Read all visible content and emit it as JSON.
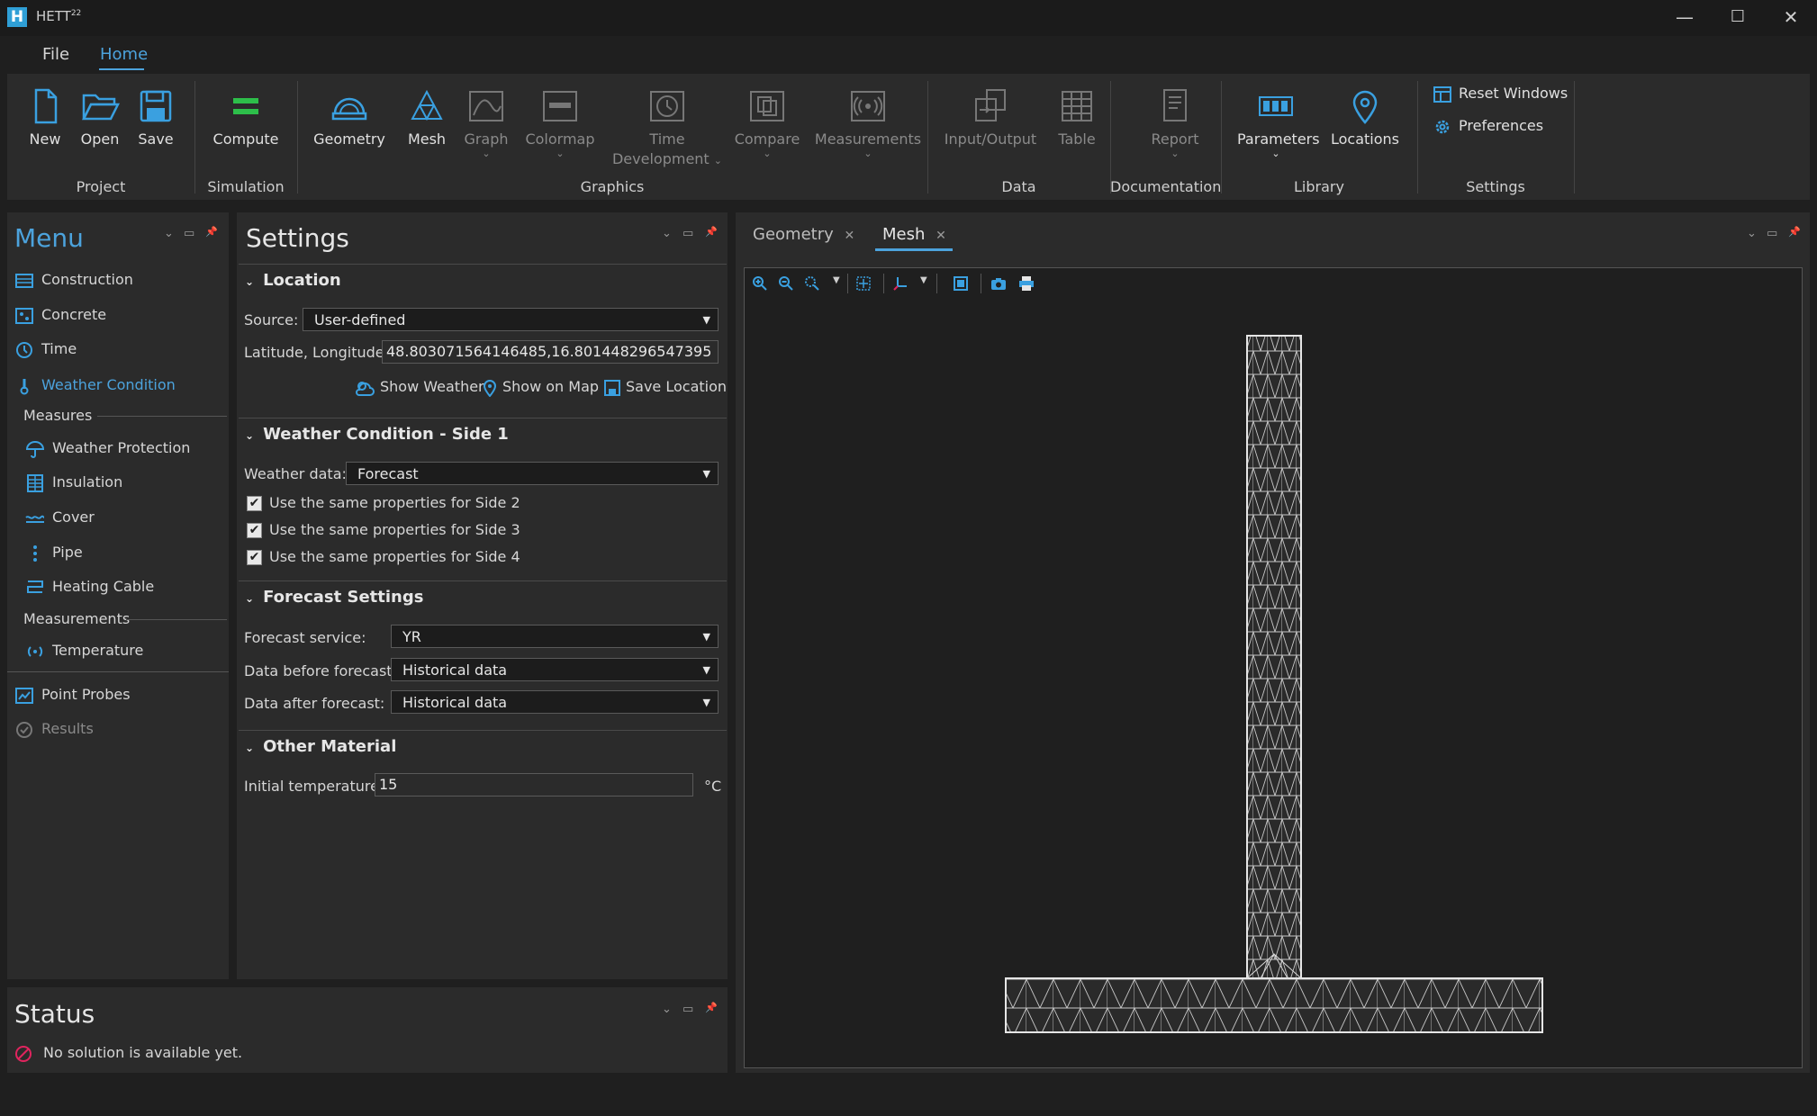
{
  "app": {
    "title": "HETT",
    "title_sup": "22",
    "logo_letter": "H"
  },
  "window_controls": {
    "minimize": "—",
    "maximize": "☐",
    "close": "✕"
  },
  "menu_tabs": [
    {
      "label": "File"
    },
    {
      "label": "Home"
    }
  ],
  "ribbon": {
    "buttons": {
      "new": "New",
      "open": "Open",
      "save": "Save",
      "compute": "Compute",
      "geometry": "Geometry",
      "mesh": "Mesh",
      "graph": "Graph",
      "colormap": "Colormap",
      "time_development_1": "Time",
      "time_development_2": "Development",
      "compare": "Compare",
      "measurements": "Measurements",
      "input_output": "Input/Output",
      "table": "Table",
      "report": "Report",
      "parameters": "Parameters",
      "locations": "Locations",
      "reset_windows": "Reset Windows",
      "preferences": "Preferences"
    },
    "groups": {
      "project": "Project",
      "simulation": "Simulation",
      "graphics": "Graphics",
      "data": "Data",
      "documentation": "Documentation",
      "library": "Library",
      "settings": "Settings"
    },
    "dropdown_glyph": "⌄"
  },
  "menu_panel": {
    "title": "Menu",
    "items": {
      "construction": "Construction",
      "concrete": "Concrete",
      "time": "Time",
      "weather_condition": "Weather Condition",
      "measures_header": "Measures",
      "weather_protection": "Weather Protection",
      "insulation": "Insulation",
      "cover": "Cover",
      "pipe": "Pipe",
      "heating_cable": "Heating Cable",
      "measurements_header": "Measurements",
      "temperature": "Temperature",
      "point_probes": "Point Probes",
      "results": "Results"
    }
  },
  "panel_controls": {
    "dropdown": "⌄",
    "maximize": "▭",
    "pin": "📌"
  },
  "settings": {
    "title": "Settings",
    "location": {
      "header": "Location",
      "source_label": "Source:",
      "source_value": "User-defined",
      "latlon_label": "Latitude, Longitude:",
      "latlon_value": "48.803071564146485,16.801448296547395",
      "show_weather": "Show Weather",
      "show_on_map": "Show on Map",
      "save_location": "Save Location"
    },
    "weather": {
      "header": "Weather Condition - Side 1",
      "data_label": "Weather data:",
      "data_value": "Forecast",
      "side2": "Use the same properties for Side 2",
      "side3": "Use the same properties for Side 3",
      "side4": "Use the same properties for Side 4"
    },
    "forecast": {
      "header": "Forecast Settings",
      "service_label": "Forecast service:",
      "service_value": "YR",
      "before_label": "Data before forecast:",
      "before_value": "Historical data",
      "after_label": "Data after forecast:",
      "after_value": "Historical data"
    },
    "other": {
      "header": "Other Material",
      "temp_label": "Initial temperature:",
      "temp_value": "15",
      "temp_unit": "°C"
    }
  },
  "status": {
    "title": "Status",
    "message": "No solution is available yet."
  },
  "viewer": {
    "tabs": [
      {
        "label": "Geometry"
      },
      {
        "label": "Mesh"
      }
    ],
    "close_glyph": "✕",
    "toolbar": [
      "zoom-in-icon",
      "zoom-out-icon",
      "zoom-region-icon",
      "zoom-fit-icon",
      "axes-icon",
      "layout-icon",
      "camera-icon",
      "print-icon"
    ]
  },
  "colors": {
    "accent": "#4ca3dd",
    "green": "#2dbf4a",
    "background": "#1f1f1f",
    "panel": "#2b2b2b"
  }
}
